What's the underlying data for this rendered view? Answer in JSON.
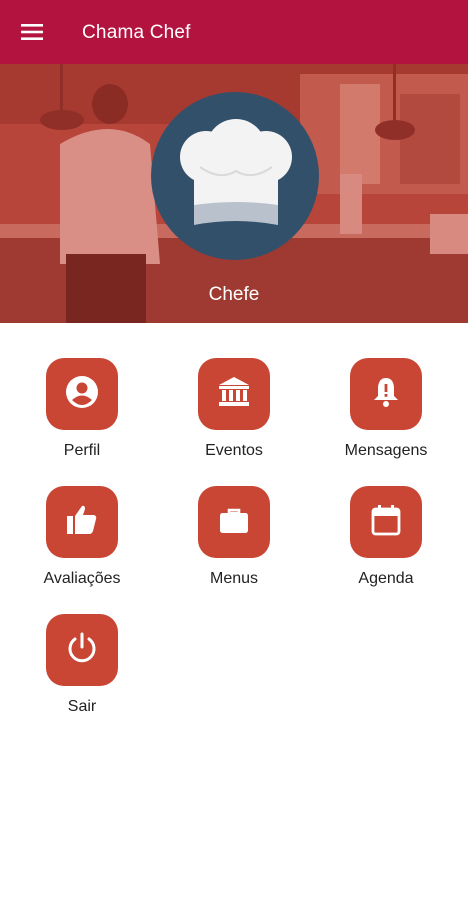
{
  "app_bar": {
    "title": "Chama Chef",
    "menu_icon": "hamburger-menu-icon",
    "background": "#b3143f"
  },
  "profile": {
    "name": "Chefe",
    "avatar_icon": "chef-hat-icon",
    "avatar_background": "#33506b"
  },
  "menu_tiles": [
    {
      "label": "Perfil",
      "icon": "account-circle-icon"
    },
    {
      "label": "Eventos",
      "icon": "bank-building-icon"
    },
    {
      "label": "Mensagens",
      "icon": "bell-alert-icon"
    },
    {
      "label": "Avaliações",
      "icon": "thumbs-up-icon"
    },
    {
      "label": "Menus",
      "icon": "briefcase-icon"
    },
    {
      "label": "Agenda",
      "icon": "calendar-icon"
    },
    {
      "label": "Sair",
      "icon": "power-icon"
    }
  ],
  "colors": {
    "tile_background": "#c94534",
    "hero_tint": "#b8453a"
  }
}
